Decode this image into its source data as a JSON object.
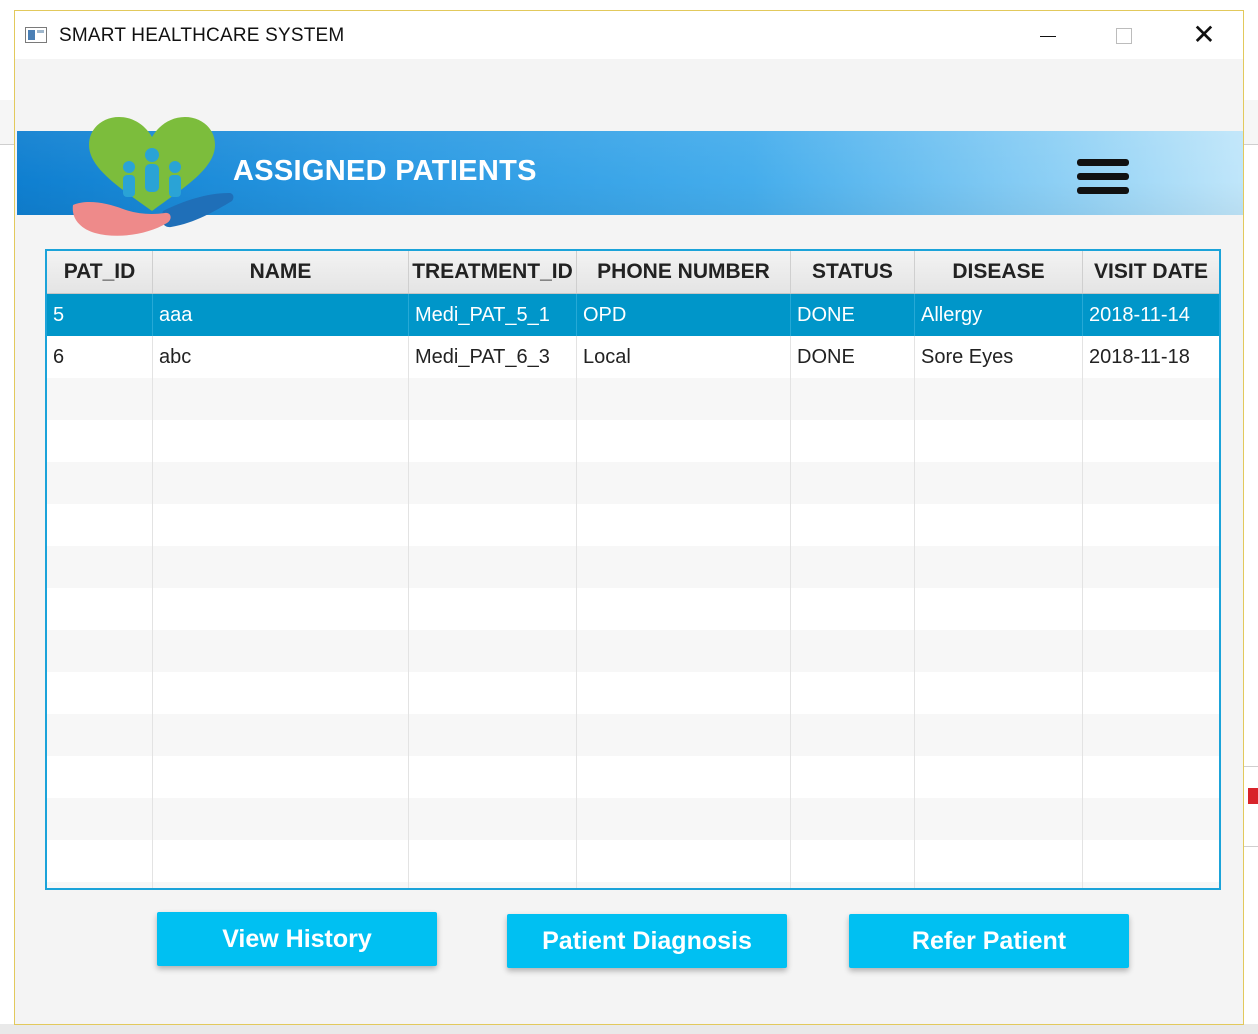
{
  "window": {
    "title": "SMART HEALTHCARE SYSTEM",
    "close_glyph": "✕"
  },
  "header": {
    "title": "ASSIGNED PATIENTS",
    "menu_icon": "hamburger-menu-icon",
    "logo": "healthcare-logo-icon"
  },
  "table": {
    "columns": [
      "PAT_ID",
      "NAME",
      "TREATMENT_ID",
      "PHONE NUMBER",
      "STATUS",
      "DISEASE",
      "VISIT DATE"
    ],
    "rows": [
      [
        "5",
        "aaa",
        "Medi_PAT_5_1",
        "OPD",
        "DONE",
        "Allergy",
        "2018-11-14"
      ],
      [
        "6",
        "abc",
        "Medi_PAT_6_3",
        "Local",
        "DONE",
        "Sore Eyes",
        "2018-11-18"
      ]
    ],
    "selected_row": 0
  },
  "buttons": {
    "view_history": "View History",
    "patient_diagnosis": "Patient Diagnosis",
    "refer_patient": "Refer Patient"
  },
  "colors": {
    "accent": "#00c0f2",
    "selection": "#0096c9",
    "table_border": "#1ba3d9",
    "banner_start": "#0f7fd0",
    "banner_end": "#c0e6fa"
  }
}
